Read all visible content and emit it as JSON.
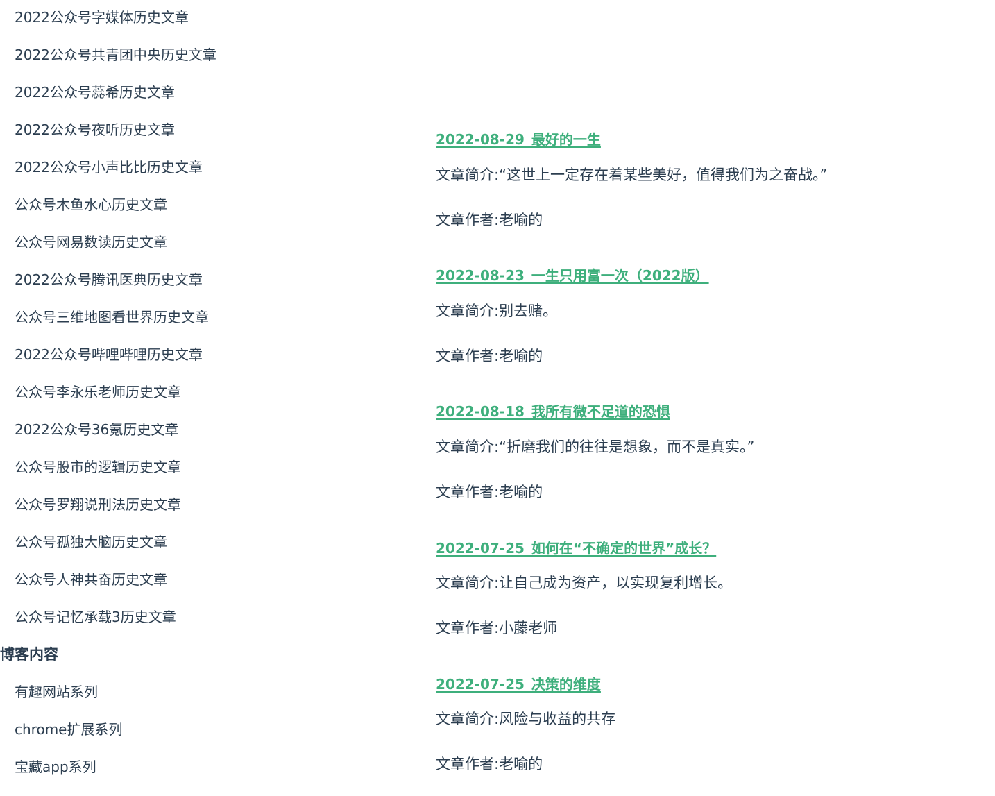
{
  "sidebar": {
    "links_top": [
      "2022公众号字媒体历史文章",
      "2022公众号共青团中央历史文章",
      "2022公众号蕊希历史文章",
      "2022公众号夜听历史文章",
      "2022公众号小声比比历史文章",
      "公众号木鱼水心历史文章",
      "公众号网易数读历史文章",
      "2022公众号腾讯医典历史文章",
      "公众号三维地图看世界历史文章",
      "2022公众号哔哩哔哩历史文章",
      "公众号李永乐老师历史文章",
      "2022公众号36氪历史文章",
      "公众号股市的逻辑历史文章",
      "公众号罗翔说刑法历史文章",
      "公众号孤独大脑历史文章",
      "公众号人神共奋历史文章",
      "公众号记忆承载3历史文章"
    ],
    "heading": "博客内容",
    "links_bottom": [
      "有趣网站系列",
      "chrome扩展系列",
      "宝藏app系列"
    ]
  },
  "articles": [
    {
      "title": "2022-08-29_最好的一生",
      "summary": "文章简介:“这世上一定存在着某些美好，值得我们为之奋战。”",
      "author": "文章作者:老喻的"
    },
    {
      "title": "2022-08-23_一生只用富一次（2022版）",
      "summary": "文章简介:别去赌。",
      "author": "文章作者:老喻的"
    },
    {
      "title": "2022-08-18_我所有微不足道的恐惧",
      "summary": "文章简介:“折磨我们的往往是想象，而不是真实。”",
      "author": "文章作者:老喻的"
    },
    {
      "title": "2022-07-25_如何在“不确定的世界”成长？",
      "summary": "文章简介:让自己成为资产，以实现复利增长。",
      "author": "文章作者:小藤老师"
    },
    {
      "title": "2022-07-25_决策的维度",
      "summary": "文章简介:风险与收益的共存",
      "author": "文章作者:老喻的"
    }
  ],
  "colors": {
    "accent": "#3eaf7c",
    "text": "#2c3e50",
    "divider": "#eaecef"
  }
}
